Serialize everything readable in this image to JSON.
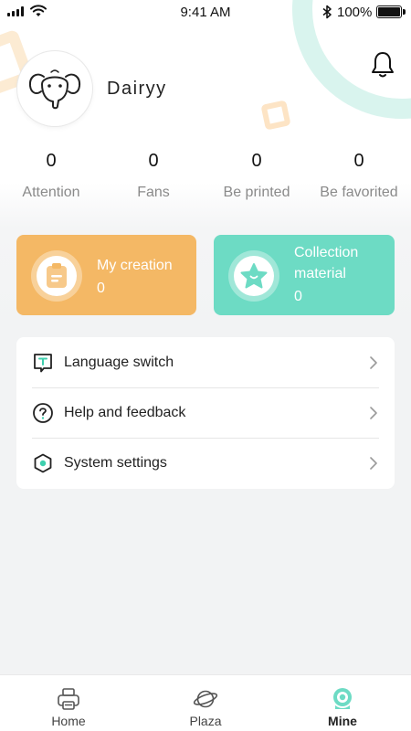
{
  "status_bar": {
    "time": "9:41 AM",
    "battery": "100%"
  },
  "profile": {
    "username": "Dairyy"
  },
  "stats": [
    {
      "value": "0",
      "label": "Attention"
    },
    {
      "value": "0",
      "label": "Fans"
    },
    {
      "value": "0",
      "label": "Be printed"
    },
    {
      "value": "0",
      "label": "Be favorited"
    }
  ],
  "cards": {
    "creation": {
      "title": "My creation",
      "count": "0",
      "color": "#f4b865",
      "icon": "clipboard-icon"
    },
    "collection": {
      "title": "Collection material",
      "count": "0",
      "color": "#6ddbc4",
      "icon": "star-icon"
    }
  },
  "menu": [
    {
      "label": "Language switch",
      "icon": "language-icon"
    },
    {
      "label": "Help and feedback",
      "icon": "help-icon"
    },
    {
      "label": "System settings",
      "icon": "settings-icon"
    }
  ],
  "tabs": [
    {
      "label": "Home",
      "icon": "printer-icon",
      "active": false
    },
    {
      "label": "Plaza",
      "icon": "planet-icon",
      "active": false
    },
    {
      "label": "Mine",
      "icon": "camera-icon",
      "active": true
    }
  ],
  "colors": {
    "accent_teal": "#6ddbc4",
    "accent_orange": "#f4b865",
    "background": "#f2f3f4"
  }
}
